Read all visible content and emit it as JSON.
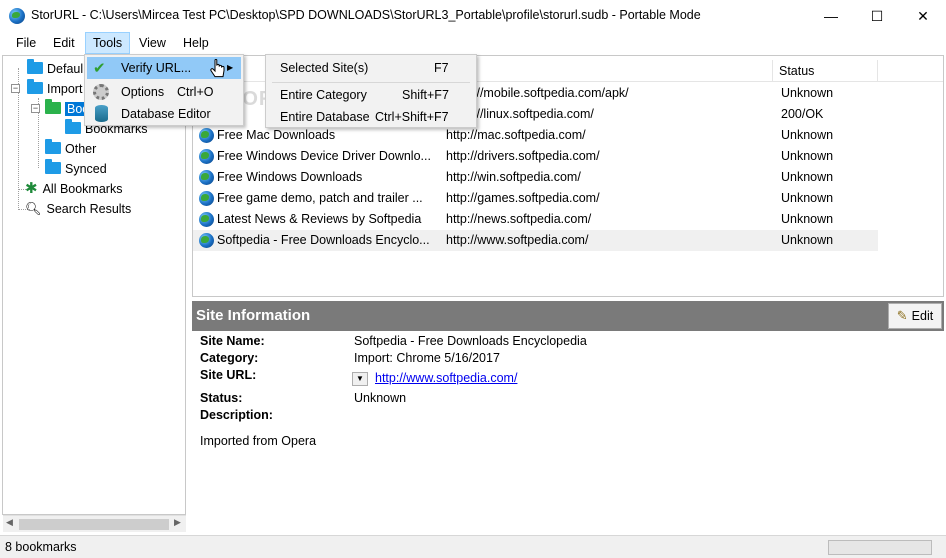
{
  "window": {
    "title": "StorURL - C:\\Users\\Mircea Test PC\\Desktop\\SPD DOWNLOADS\\StorURL3_Portable\\profile\\storurl.sudb - Portable Mode",
    "minimize": "—",
    "maximize": "☐",
    "close": "✕"
  },
  "menubar": {
    "file": "File",
    "edit": "Edit",
    "tools": "Tools",
    "view": "View",
    "help": "Help"
  },
  "tools_menu": {
    "verify_url": "Verify URL...",
    "options": "Options",
    "options_key": "Ctrl+O",
    "database_editor": "Database Editor",
    "submenu_arrow": "▶"
  },
  "verify_submenu": {
    "selected_sites": "Selected Site(s)",
    "selected_sites_key": "F7",
    "entire_category": "Entire Category",
    "entire_category_key": "Shift+F7",
    "entire_database": "Entire Database",
    "entire_database_key": "Ctrl+Shift+F7"
  },
  "tree": {
    "items": [
      {
        "label": "Defaul"
      },
      {
        "label": "Import"
      },
      {
        "label": "Boo"
      },
      {
        "label": "Bookmarks"
      },
      {
        "label": "Other"
      },
      {
        "label": "Synced"
      },
      {
        "label": "All Bookmarks"
      },
      {
        "label": "Search Results"
      }
    ]
  },
  "list": {
    "columns": {
      "status": "Status"
    },
    "rows": [
      {
        "name": "",
        "url": "://mobile.softpedia.com/apk/",
        "status": "Unknown"
      },
      {
        "name": "",
        "url": "://linux.softpedia.com/",
        "status": "200/OK"
      },
      {
        "name": "Free Mac Downloads",
        "url": "http://mac.softpedia.com/",
        "status": "Unknown"
      },
      {
        "name": "Free Windows Device Driver Downlo...",
        "url": "http://drivers.softpedia.com/",
        "status": "Unknown"
      },
      {
        "name": "Free Windows Downloads",
        "url": "http://win.softpedia.com/",
        "status": "Unknown"
      },
      {
        "name": "Free game demo, patch and trailer ...",
        "url": "http://games.softpedia.com/",
        "status": "Unknown"
      },
      {
        "name": "Latest News & Reviews by Softpedia",
        "url": "http://news.softpedia.com/",
        "status": "Unknown"
      },
      {
        "name": "Softpedia - Free Downloads Encyclo...",
        "url": "http://www.softpedia.com/",
        "status": "Unknown"
      }
    ]
  },
  "site_info": {
    "header": "Site Information",
    "edit_button": "Edit",
    "site_name_label": "Site Name:",
    "site_name": "Softpedia - Free Downloads Encyclopedia",
    "category_label": "Category:",
    "category": "Import: Chrome 5/16/2017",
    "site_url_label": "Site URL:",
    "site_url": "http://www.softpedia.com/",
    "url_dropdown": "▼",
    "status_label": "Status:",
    "status": "Unknown",
    "description_label": "Description:",
    "description": "Imported from Opera"
  },
  "statusbar": {
    "text": "8 bookmarks"
  },
  "watermark": "SOFTPEDIA"
}
